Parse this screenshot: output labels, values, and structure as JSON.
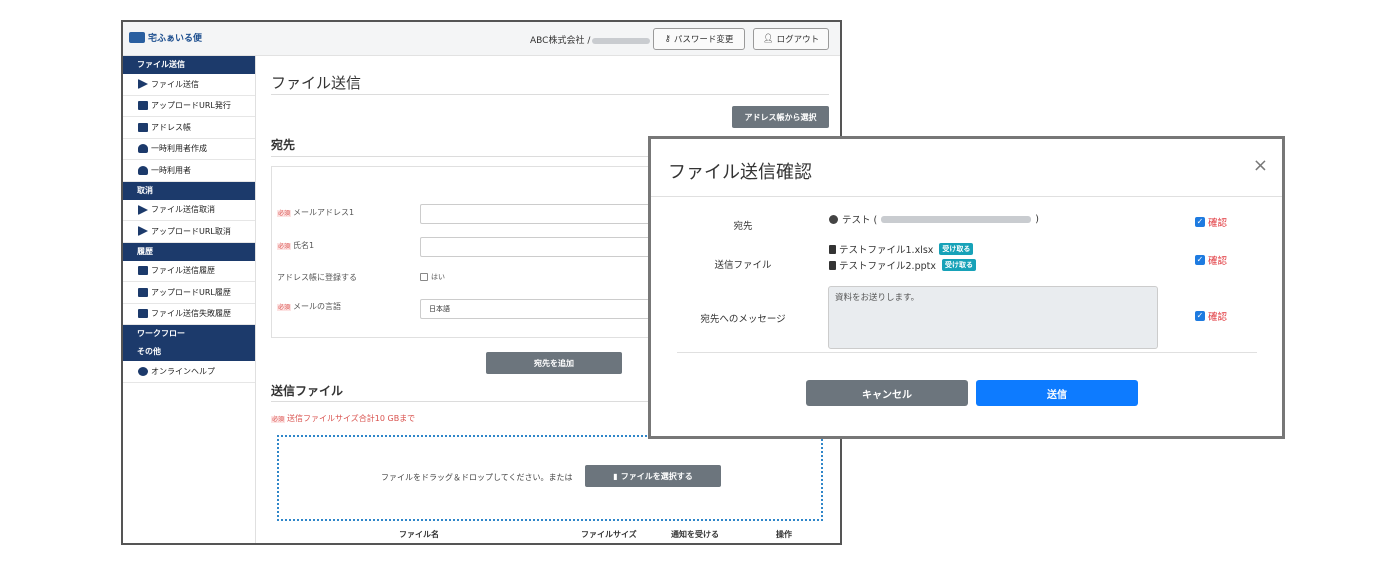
{
  "header": {
    "logo_text": "宅ふぁいる便",
    "company": "ABC株式会社 /",
    "password_btn": "パスワード変更",
    "logout_btn": "ログアウト"
  },
  "sidebar": {
    "sections": [
      {
        "title": "ファイル送信",
        "items": [
          {
            "label": "ファイル送信",
            "icon": "send-icon"
          },
          {
            "label": "アップロードURL発行",
            "icon": "upload-url-icon"
          },
          {
            "label": "アドレス帳",
            "icon": "address-book-icon"
          },
          {
            "label": "一時利用者作成",
            "icon": "user-add-icon"
          },
          {
            "label": "一時利用者",
            "icon": "user-icon"
          }
        ]
      },
      {
        "title": "取消",
        "items": [
          {
            "label": "ファイル送信取消",
            "icon": "send-cancel-icon"
          },
          {
            "label": "アップロードURL取消",
            "icon": "upload-cancel-icon"
          }
        ]
      },
      {
        "title": "履歴",
        "items": [
          {
            "label": "ファイル送信履歴",
            "icon": "send-history-icon"
          },
          {
            "label": "アップロードURL履歴",
            "icon": "upload-history-icon"
          },
          {
            "label": "ファイル送信失敗履歴",
            "icon": "fail-history-icon"
          }
        ]
      },
      {
        "title": "ワークフロー",
        "items": []
      },
      {
        "title": "その他",
        "items": [
          {
            "label": "オンラインヘルプ",
            "icon": "help-icon"
          }
        ]
      }
    ]
  },
  "main": {
    "title": "ファイル送信",
    "address_book_btn": "アドレス帳から選択",
    "recipient_heading": "宛先",
    "required_tag": "必須",
    "fields": {
      "email_label": "メールアドレス1",
      "name_label": "氏名1",
      "register_label": "アドレス帳に登録する",
      "register_option": "はい",
      "language_label": "メールの言語",
      "language_value": "日本語"
    },
    "add_recipient_btn": "宛先を追加",
    "files_heading": "送信ファイル",
    "size_note": "送信ファイルサイズ合計10 GBまで",
    "drop_text": "ファイルをドラッグ＆ドロップしてください。または",
    "select_file_btn": "ファイルを選択する",
    "table_headers": [
      "ファイル名",
      "ファイルサイズ",
      "通知を受ける",
      "操作"
    ]
  },
  "modal": {
    "title": "ファイル送信確認",
    "close": "×",
    "recipient_label": "宛先",
    "recipient_name": "テスト (",
    "recipient_end": ")",
    "files_label": "送信ファイル",
    "files": [
      {
        "name": "テストファイル1.xlsx",
        "badge": "受け取る"
      },
      {
        "name": "テストファイル2.pptx",
        "badge": "受け取る"
      }
    ],
    "message_label": "宛先へのメッセージ",
    "message": "資料をお送りします。",
    "confirm_label": "確認",
    "cancel_btn": "キャンセル",
    "send_btn": "送信"
  },
  "colors": {
    "sidebar_header": "#1c3a6b",
    "accent_blue": "#0d7bff",
    "badge": "#17a2b8",
    "required_red": "#d9534f"
  }
}
